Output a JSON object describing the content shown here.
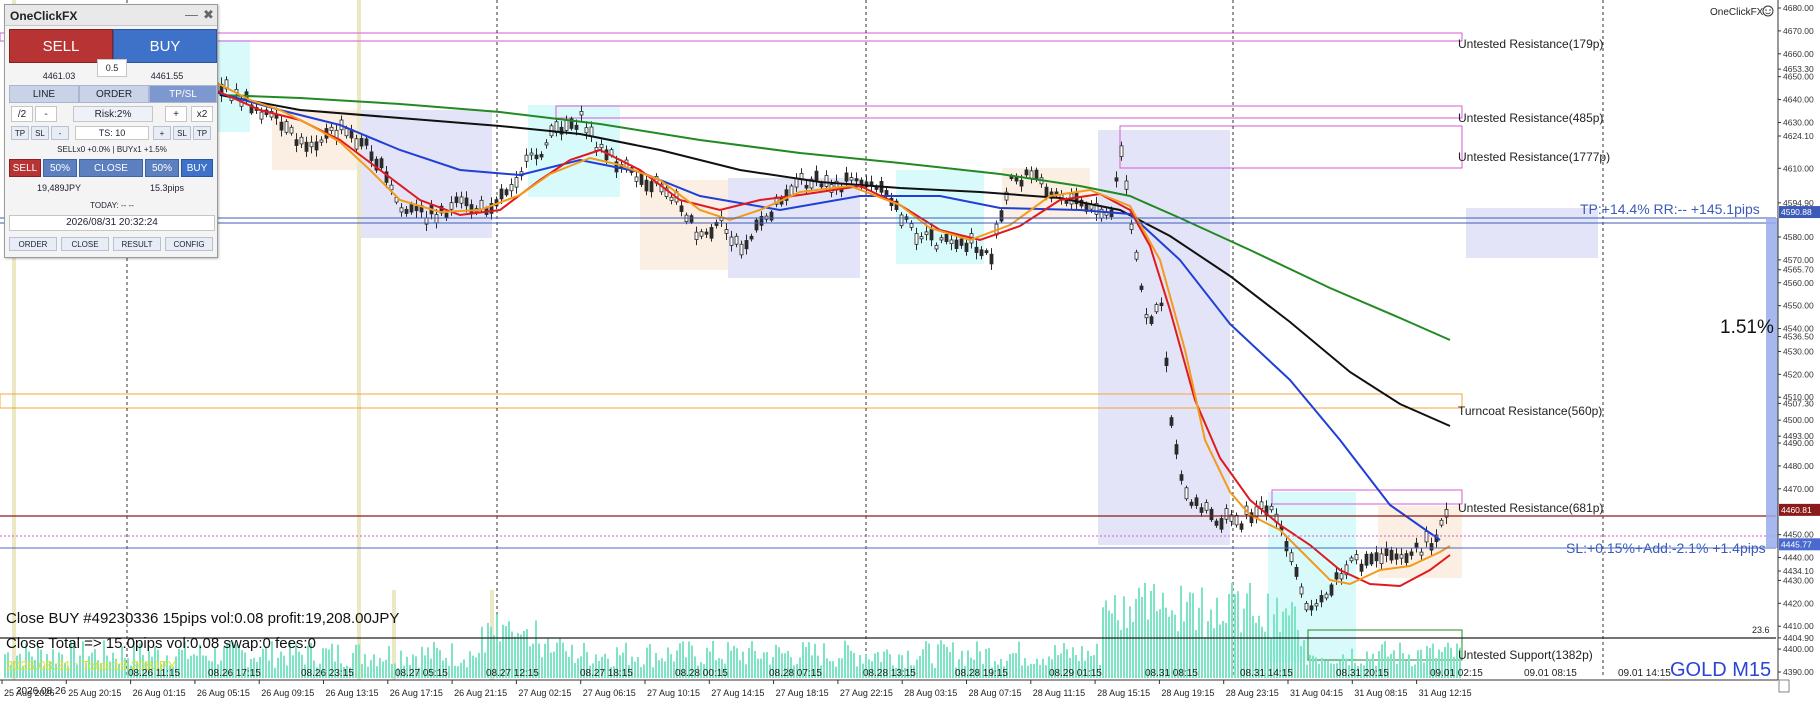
{
  "colors": {
    "bull": "#2b2b2b",
    "bear": "#2b2b2b",
    "ma_red": "#e0191f",
    "ma_orange": "#f39a1b",
    "ma_blue": "#1f3fd6",
    "ma_black": "#111111",
    "ma_green": "#228a22",
    "volume": "#7fe3c6",
    "zone_blue": "#e3e4f7",
    "zone_peach": "#fbeee2",
    "zone_cyan": "#d8fafa",
    "zone_olive": "#ece8c4",
    "magenta": "#d65bd6",
    "orange_line": "#f3a53a",
    "price_line": "#8b1a1a",
    "tp_line": "#3c5bb8",
    "sl_line": "#4a6ad0"
  },
  "panel": {
    "title": "OneClickFX",
    "minimize_icon": "minimize-icon",
    "close_icon": "close-icon",
    "sell_label": "SELL",
    "buy_label": "BUY",
    "lot": "0.5",
    "sell_price": "4461.03",
    "buy_price": "4461.55",
    "tabs": [
      "LINE",
      "ORDER",
      "TP/SL"
    ],
    "active_tab": "TP/SL",
    "row2": {
      "half": "/2",
      "minus": "-",
      "risk": "Risk:2%",
      "plus": "+",
      "double": "x2"
    },
    "row3": {
      "tp": "TP",
      "sl": "SL",
      "minus": "-",
      "ts": "TS: 10",
      "plus": "+",
      "sl2": "SL",
      "tp2": "TP"
    },
    "status_line": "SELLx0 +0.0% | BUYx1 +1.5%",
    "close_row": {
      "sell": "SELL",
      "pct1": "50%",
      "close": "CLOSE",
      "pct2": "50%",
      "buy": "BUY"
    },
    "profit_jpy": "19,489JPY",
    "profit_pips": "15.3pips",
    "today": "TODAY: -- --",
    "datetime": "2026/08/31  20:32:24",
    "bottom_buttons": [
      "ORDER",
      "CLOSE",
      "RESULT",
      "CONFIG"
    ]
  },
  "chart": {
    "brand": "OneClickFX",
    "smiley_icon": "smiley-icon",
    "symbol_label": "GOLD M15",
    "percent_label": "1.51%",
    "tp_label": "TP:+14.4% RR:-- +145.1pips",
    "sl_label": "SL:+0.15%+Add:-2.1% +1.4pips",
    "current_price": "4460.81",
    "tp_price": "4590.88",
    "sl_price": "4445.77",
    "osc_value": "23.6",
    "zones_text": [
      "Untested Resistance(179p)",
      "Untested Resistance(485p)",
      "Untested Resistance(1777p)",
      "Turncoat Resistance(560p)",
      "Untested Resistance(681p)",
      "Untested Support(1382p)"
    ],
    "close_msg1": "Close BUY #49230336 15pips vol:0.08 profit:19,208.00JPY",
    "close_msg2": "Close Total => 15.0pips vol:0.08 swap:0 fees:0",
    "close_msg3": "2026.08.31 : Total:19,208JPY",
    "date_top_left": "2026.08.26",
    "axis_top": [
      "08.26 11:15",
      "08.26 17:15",
      "08.26 23:15",
      "08.27 05:15",
      "08.27 12:15",
      "08.27 18:15",
      "08.28 00:15",
      "08.28 07:15",
      "08.28 13:15",
      "08.28 19:15",
      "08.29 01:15",
      "08.31 08:15",
      "08.31 14:15",
      "08.31 20:15",
      "09.01 02:15",
      "09.01 08:15",
      "09.01 14:15"
    ],
    "axis_bottom": [
      "25 Aug 2026",
      "25 Aug 20:15",
      "26 Aug 01:15",
      "26 Aug 05:15",
      "26 Aug 09:15",
      "26 Aug 13:15",
      "26 Aug 17:15",
      "26 Aug 21:15",
      "27 Aug 02:15",
      "27 Aug 06:15",
      "27 Aug 10:15",
      "27 Aug 14:15",
      "27 Aug 18:15",
      "27 Aug 22:15",
      "28 Aug 03:15",
      "28 Aug 07:15",
      "28 Aug 11:15",
      "28 Aug 15:15",
      "28 Aug 19:15",
      "28 Aug 23:15",
      "31 Aug 04:15",
      "31 Aug 08:15",
      "31 Aug 12:15"
    ],
    "price_axis": [
      "4680.00",
      "4670.00",
      "4660.00",
      "4653.30",
      "4650.00",
      "4640.00",
      "4630.00",
      "4624.10",
      "4610.00",
      "4594.90",
      "4590.88",
      "4580.00",
      "4570.00",
      "4565.70",
      "4560.00",
      "4550.00",
      "4540.00",
      "4536.50",
      "4530.00",
      "4520.00",
      "4510.00",
      "4507.30",
      "4500.00",
      "4493.00",
      "4490.00",
      "4480.00",
      "4470.00",
      "4460.81",
      "4450.00",
      "4445.77",
      "4440.00",
      "4434.10",
      "4430.00",
      "4420.00",
      "4410.00",
      "4404.90",
      "4400.00",
      "4390.00"
    ]
  }
}
